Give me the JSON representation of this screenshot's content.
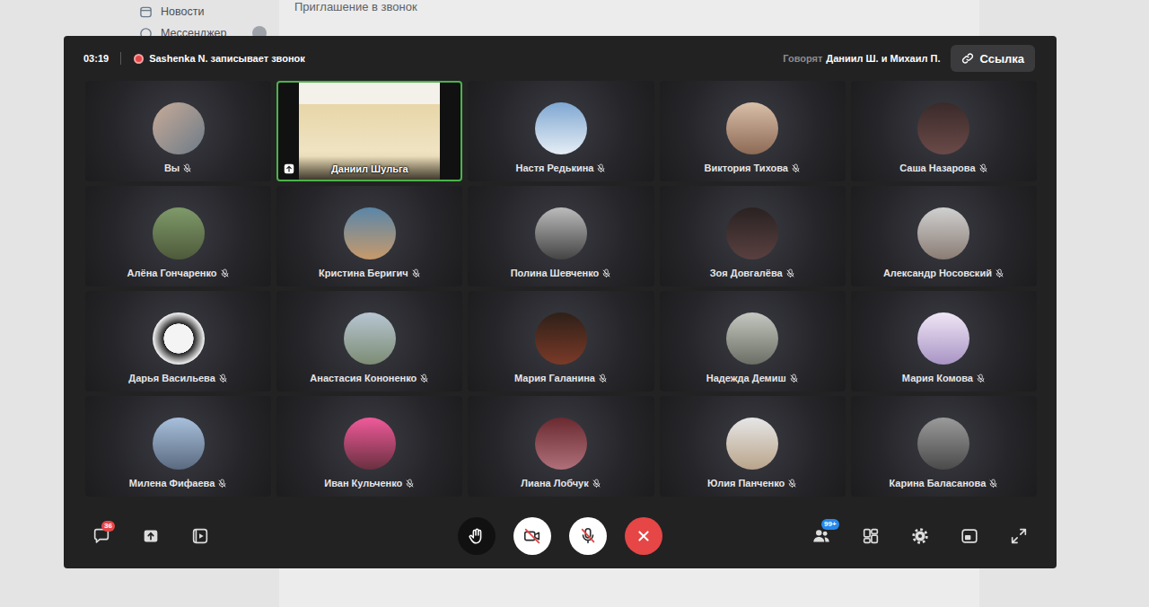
{
  "page": {
    "sidebar": [
      {
        "label": "Новости",
        "badge": false
      },
      {
        "label": "Мессенджер",
        "badge": true
      }
    ],
    "content_title": "Приглашение в звонок"
  },
  "call": {
    "timer": "03:19",
    "recording": {
      "active": true,
      "text": "Sashenka N. записывает звонок"
    },
    "speaking": {
      "label": "Говорят",
      "names": "Даниил Ш. и Михаил П."
    },
    "link_button": "Ссылка",
    "participants": [
      {
        "name": "Вы",
        "kind": "avatar",
        "muted": true,
        "speaking": false
      },
      {
        "name": "Даниил Шульга",
        "kind": "screen",
        "muted": false,
        "speaking": true
      },
      {
        "name": "Настя Редькина",
        "kind": "avatar",
        "muted": true,
        "speaking": false
      },
      {
        "name": "Виктория Тихова",
        "kind": "avatar",
        "muted": true,
        "speaking": false
      },
      {
        "name": "Саша Назарова",
        "kind": "avatar",
        "muted": true,
        "speaking": false
      },
      {
        "name": "Алёна Гончаренко",
        "kind": "avatar",
        "muted": true,
        "speaking": false
      },
      {
        "name": "Кристина Беригич",
        "kind": "avatar",
        "muted": true,
        "speaking": false
      },
      {
        "name": "Полина Шевченко",
        "kind": "avatar",
        "muted": true,
        "speaking": false
      },
      {
        "name": "Зоя Довгалёва",
        "kind": "avatar",
        "muted": true,
        "speaking": false
      },
      {
        "name": "Александр Носовский",
        "kind": "avatar",
        "muted": true,
        "speaking": false
      },
      {
        "name": "Дарья Васильева",
        "kind": "avatar",
        "muted": true,
        "speaking": false
      },
      {
        "name": "Анастасия Кононенко",
        "kind": "avatar",
        "muted": true,
        "speaking": false
      },
      {
        "name": "Мария Галанина",
        "kind": "avatar",
        "muted": true,
        "speaking": false
      },
      {
        "name": "Надежда Демиш",
        "kind": "avatar",
        "muted": true,
        "speaking": false
      },
      {
        "name": "Мария Комова",
        "kind": "avatar",
        "muted": true,
        "speaking": false
      },
      {
        "name": "Милена Фифаева",
        "kind": "avatar",
        "muted": true,
        "speaking": false
      },
      {
        "name": "Иван Кульченко",
        "kind": "avatar",
        "muted": true,
        "speaking": false
      },
      {
        "name": "Лиана Лобчук",
        "kind": "avatar",
        "muted": true,
        "speaking": false
      },
      {
        "name": "Юлия Панченко",
        "kind": "avatar",
        "muted": true,
        "speaking": false
      },
      {
        "name": "Карина Баласанова",
        "kind": "avatar",
        "muted": true,
        "speaking": false
      }
    ],
    "controls": {
      "chat_badge": "36",
      "hand_raised": false,
      "camera_on": false,
      "mic_on": false,
      "participants_badge": "99+"
    }
  }
}
